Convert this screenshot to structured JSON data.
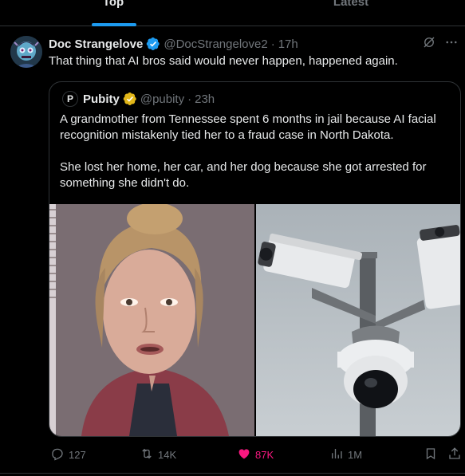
{
  "tabs": [
    {
      "label": "Top",
      "active": true
    },
    {
      "label": "Latest",
      "active": false
    }
  ],
  "tweet": {
    "author_name": "Doc Strangelove",
    "handle": "@DocStrangelove2",
    "separator": "·",
    "time": "17h",
    "text": "That thing that AI bros said would never happen, happened again.",
    "verified_color": "#1d9bf0"
  },
  "quoted": {
    "avatar_letter": "P",
    "author_name": "Pubity",
    "handle": "@pubity",
    "separator": "·",
    "time": "23h",
    "verified_color": "#e2b719",
    "paragraph1": "A grandmother from Tennessee spent 6 months in jail because AI facial recognition mistakenly tied her to a fraud case in North Dakota.",
    "paragraph2": "She lost her home, her car, and her dog because she got arrested for something she didn't do."
  },
  "actions": {
    "replies": "127",
    "retweets": "14K",
    "likes": "87K",
    "views": "1M",
    "liked": true,
    "like_color": "#f91880"
  },
  "icons": {
    "grok": "grok-icon",
    "more": "more-icon",
    "reply": "reply-icon",
    "retweet": "retweet-icon",
    "like": "heart-icon",
    "views": "views-icon",
    "bookmark": "bookmark-icon",
    "share": "share-icon"
  }
}
